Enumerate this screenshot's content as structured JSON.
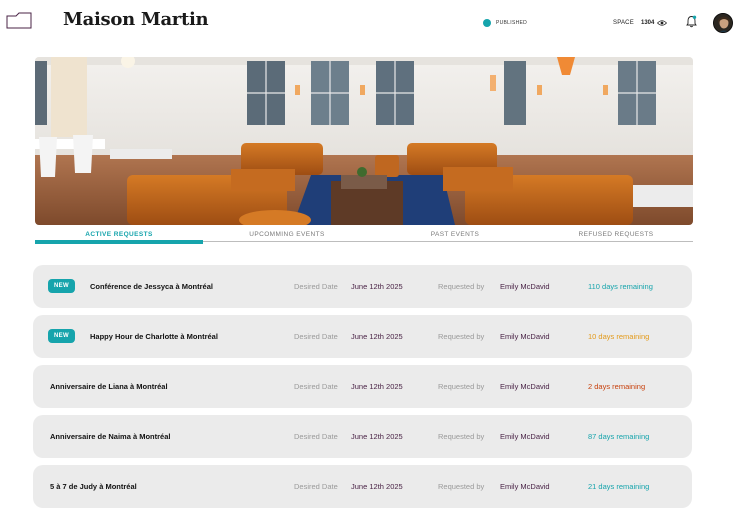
{
  "header": {
    "brand": "Maison Martin",
    "status": "PUBLISHED",
    "space_label": "SPACE",
    "views": "1304"
  },
  "colors": {
    "accent": "#16a4ac",
    "orange": "#e39a1a",
    "red": "#c7410d",
    "purple": "#4a2346"
  },
  "tabs": [
    {
      "label": "ACTIVE REQUESTS",
      "active": true
    },
    {
      "label": "UPCOMMING EVENTS",
      "active": false
    },
    {
      "label": "PAST EVENTS",
      "active": false
    },
    {
      "label": "REFUSED REQUESTS",
      "active": false
    }
  ],
  "labels": {
    "desired_date": "Desired Date",
    "requested_by": "Requested by"
  },
  "requests": [
    {
      "badge": "NEW",
      "event": "Conférence de Jessyca à Montréal",
      "date": "June 12th 2025",
      "requester": "Emily McDavid",
      "remaining": "110 days remaining",
      "remaining_color": "#16a4ac"
    },
    {
      "badge": "NEW",
      "event": "Happy Hour de Charlotte à Montréal",
      "date": "June 12th 2025",
      "requester": "Emily McDavid",
      "remaining": "10 days remaining",
      "remaining_color": "#e39a1a"
    },
    {
      "badge": "",
      "event": "Anniversaire de Liana à Montréal",
      "date": "June 12th 2025",
      "requester": "Emily McDavid",
      "remaining": "2 days remaining",
      "remaining_color": "#c7410d"
    },
    {
      "badge": "",
      "event": "Anniversaire de Naima à Montréal",
      "date": "June 12th 2025",
      "requester": "Emily McDavid",
      "remaining": "87 days remaining",
      "remaining_color": "#16a4ac"
    },
    {
      "badge": "",
      "event": "5 à 7 de Judy à Montréal",
      "date": "June 12th 2025",
      "requester": "Emily McDavid",
      "remaining": "21 days remaining",
      "remaining_color": "#16a4ac"
    }
  ]
}
